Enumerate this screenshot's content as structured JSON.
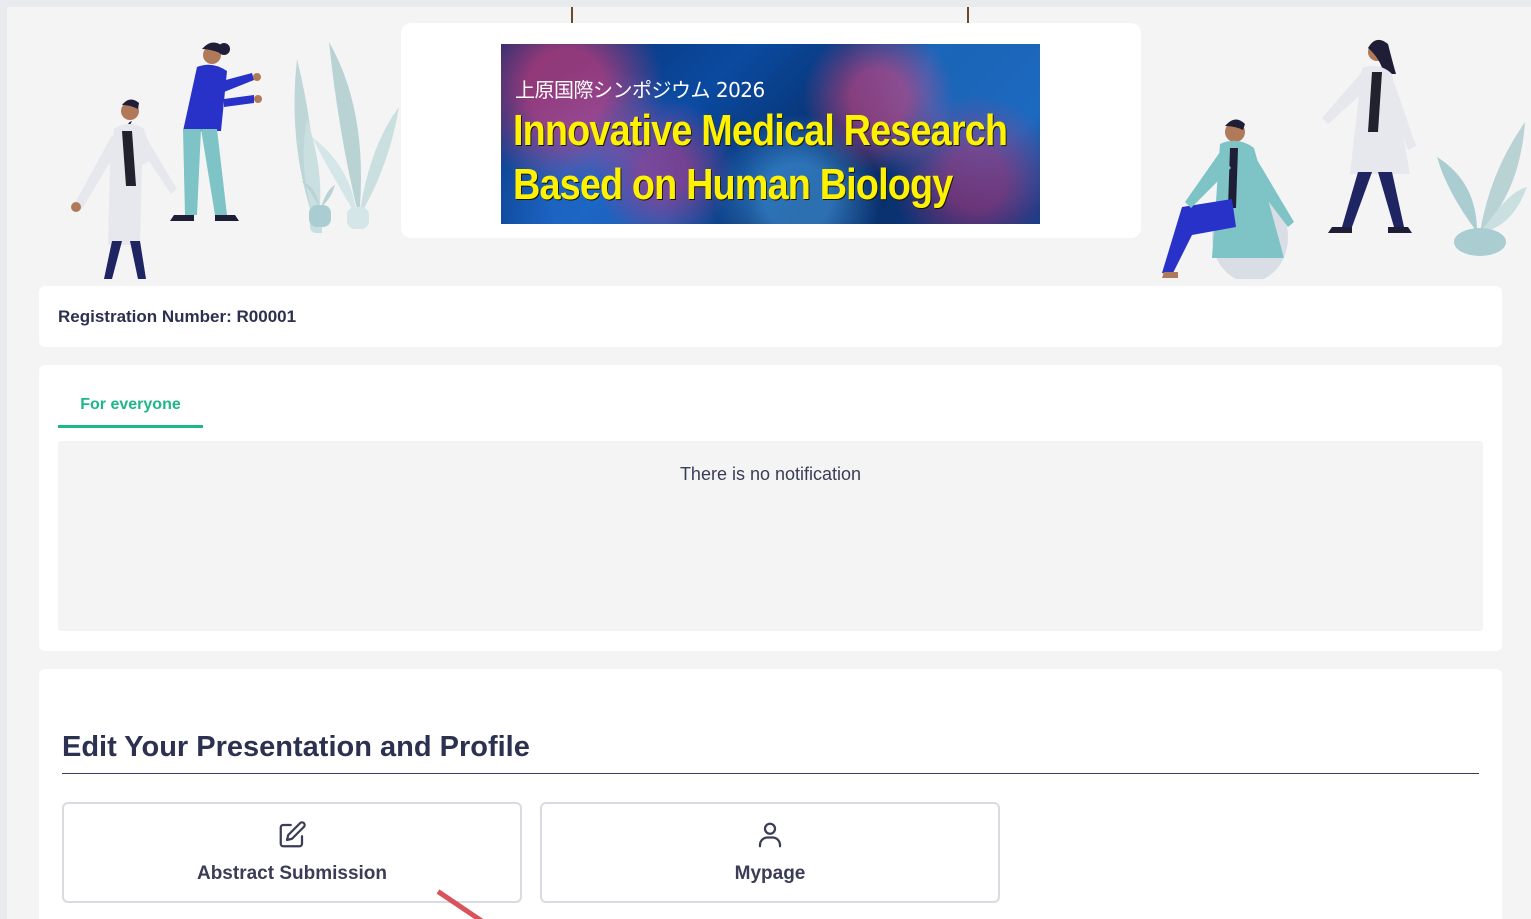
{
  "banner": {
    "jp_title": "上原国際シンポジウム 2026",
    "line1": "Innovative Medical Research",
    "line2": "Based on Human Biology"
  },
  "registration": {
    "text": "Registration Number: R00001"
  },
  "notifications": {
    "tab_label": "For everyone",
    "empty_text": "There is no notification"
  },
  "edit_section": {
    "title": "Edit Your Presentation and Profile",
    "buttons": [
      {
        "label": "Abstract Submission",
        "icon": "edit-icon"
      },
      {
        "label": "Mypage",
        "icon": "user-icon"
      }
    ]
  },
  "colors": {
    "accent": "#1fb68a",
    "text": "#2d3150",
    "banner_yellow": "#fff200"
  }
}
